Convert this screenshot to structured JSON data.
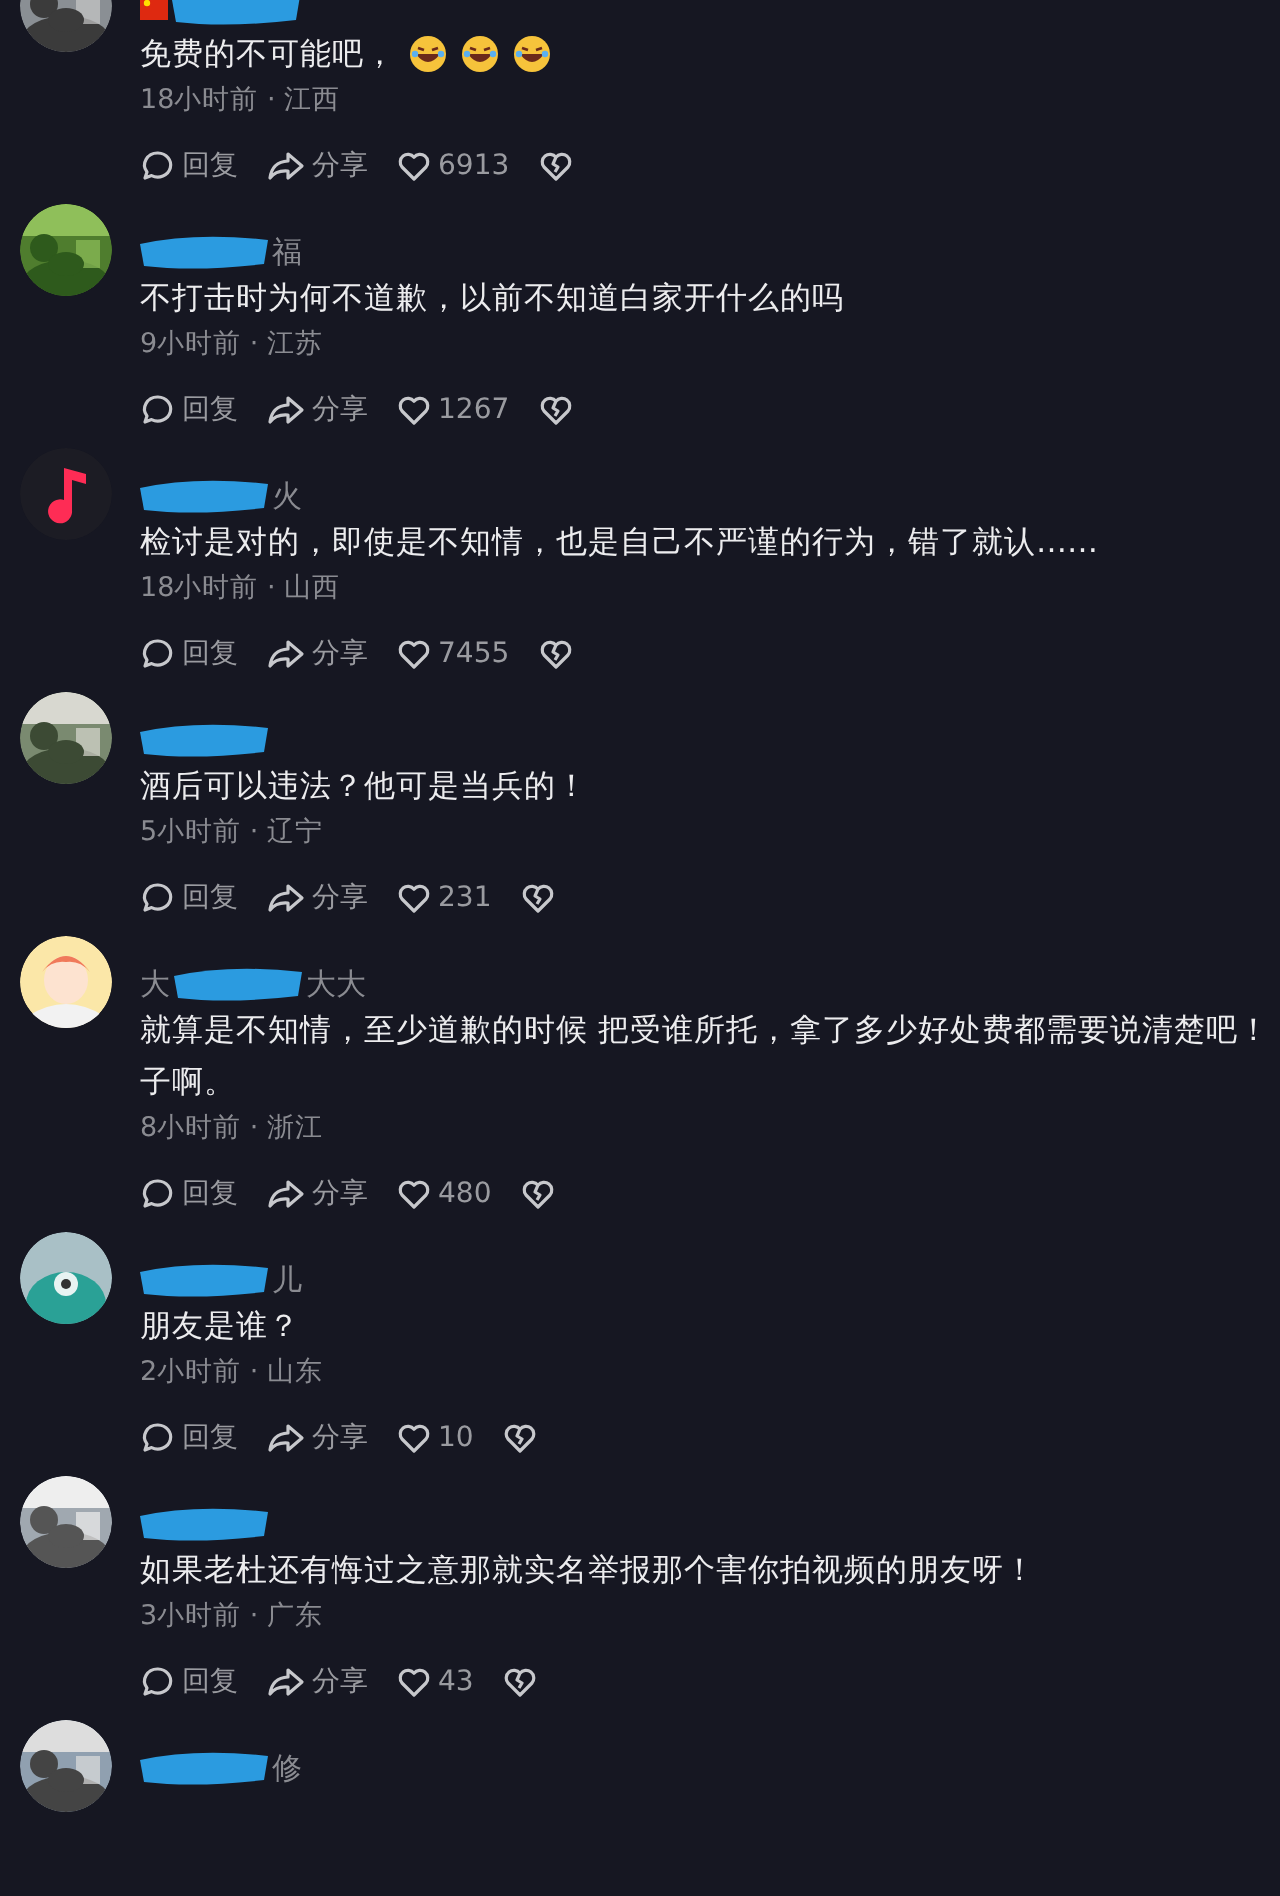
{
  "comments": [
    {
      "avatar": {
        "kind": "picture"
      },
      "name": {
        "flag": true,
        "redacted": true
      },
      "lines": [
        "免费的不可能吧，"
      ],
      "emojis": [
        {
          "kind": "laugh"
        },
        {
          "kind": "laugh"
        },
        {
          "kind": "laugh"
        }
      ],
      "meta": "18小时前 · 江西",
      "reply": "回复",
      "share": "分享",
      "likes": "6913"
    },
    {
      "avatar": {
        "kind": "picture"
      },
      "name": {
        "redacted": true,
        "after": "福"
      },
      "lines": [
        "不打击时为何不道歉，以前不知道白家开什么的吗"
      ],
      "meta": "9小时前 · 江苏",
      "reply": "回复",
      "share": "分享",
      "likes": "1267"
    },
    {
      "avatar": {
        "kind": "note"
      },
      "name": {
        "redacted": true,
        "after": "火"
      },
      "lines": [
        "检讨是对的，即使是不知情，也是自己不严谨的行为，错了就认……"
      ],
      "meta": "18小时前 · 山西",
      "reply": "回复",
      "share": "分享",
      "likes": "7455"
    },
    {
      "avatar": {
        "kind": "picture"
      },
      "name": {
        "redacted": true
      },
      "lines": [
        "酒后可以违法？他可是当兵的！"
      ],
      "meta": "5小时前 · 辽宁",
      "reply": "回复",
      "share": "分享",
      "likes": "231"
    },
    {
      "avatar": {
        "kind": "cartoon"
      },
      "name": {
        "redacted": true,
        "before": "大",
        "after": "大大"
      },
      "lines": [
        "就算是不知情，至少道歉的时候 把受谁所托，拿了多少好处费都需要说清楚吧！",
        "子啊。"
      ],
      "meta": "8小时前 · 浙江",
      "reply": "回复",
      "share": "分享",
      "likes": "480"
    },
    {
      "avatar": {
        "kind": "monster"
      },
      "name": {
        "redacted": true,
        "after": "儿"
      },
      "lines": [
        "朋友是谁？"
      ],
      "meta": "2小时前 · 山东",
      "reply": "回复",
      "share": "分享",
      "likes": "10"
    },
    {
      "avatar": {
        "kind": "picture"
      },
      "name": {
        "redacted": true
      },
      "lines": [
        "如果老杜还有悔过之意那就实名举报那个害你拍视频的朋友呀！"
      ],
      "meta": "3小时前 · 广东",
      "reply": "回复",
      "share": "分享",
      "likes": "43"
    },
    {
      "avatar": {
        "kind": "picture"
      },
      "name": {
        "redacted": true,
        "after": "修"
      }
    }
  ]
}
